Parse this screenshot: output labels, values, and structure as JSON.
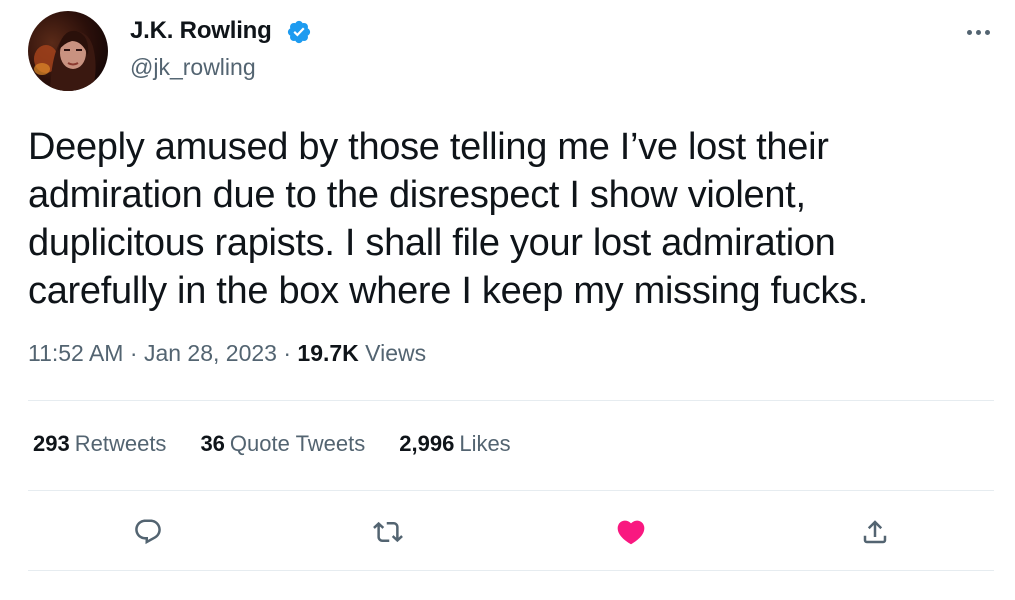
{
  "author": {
    "display_name": "J.K. Rowling",
    "handle": "@jk_rowling",
    "verified": true,
    "verified_color": "#1d9bf0"
  },
  "tweet": {
    "text": "Deeply amused by those telling me I’ve lost their\nadmiration due to the disrespect I show violent,\nduplicitous rapists. I shall file your lost admiration\ncarefully in the box where I keep my missing fucks.",
    "time": "11:52 AM",
    "date": "Jan 28, 2023",
    "separator": "·",
    "views_count": "19.7K",
    "views_label": "Views"
  },
  "stats": {
    "retweets_count": "293",
    "retweets_label": "Retweets",
    "quotes_count": "36",
    "quotes_label": "Quote Tweets",
    "likes_count": "2,996",
    "likes_label": "Likes"
  },
  "actions": {
    "reply_icon": "reply-icon",
    "retweet_icon": "retweet-icon",
    "like_icon": "heart-icon",
    "like_state": "liked",
    "like_color": "#f91880",
    "share_icon": "share-icon"
  },
  "colors": {
    "text_primary": "#0f1419",
    "text_secondary": "#536471",
    "divider": "#e6ecf0"
  }
}
